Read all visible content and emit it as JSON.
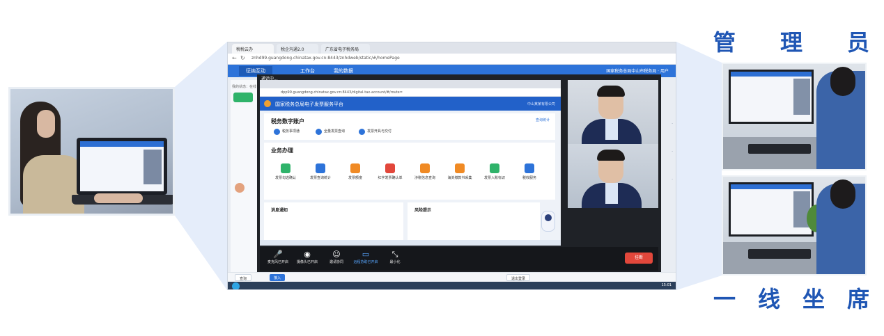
{
  "right_panel": {
    "top_heading_chars": [
      "管",
      "理",
      "员"
    ],
    "bottom_heading_chars": [
      "一",
      "线",
      "坐",
      "席"
    ]
  },
  "left_photo": {
    "icon": "person-at-laptop-photo"
  },
  "screenshot": {
    "browser": {
      "tabs": [
        "税税云办",
        "税企沟通2.0",
        "广东省电子税务局"
      ],
      "url": "znhd99.guangdong.chinatax.gov.cn:8443/znhdweb/static/#/homePage"
    },
    "app_nav": {
      "items": [
        "征纳互动",
        "工作台",
        "我的数据"
      ],
      "user": "国家税务总局中山市税务局 · 用户"
    },
    "left_side_chars": [
      "我的状态：在线",
      "首页"
    ],
    "meeting": {
      "window_title": "通话中...",
      "inner_url": "dpp99.guangdong.chinatax.gov.cn:8443/digital-tax-account/#/route=",
      "portal_title": "国家税务总局电子发票服务平台",
      "portal_right": "中山某某有限公司",
      "account_heading": "税务数字账户",
      "account_link": "查询统计",
      "quick_links": [
        "税务事项通",
        "全量发票查询",
        "发票开具与交付"
      ],
      "business_heading": "业务办理",
      "services": [
        {
          "label": "发票勾选确认",
          "color": "#2fb36a"
        },
        {
          "label": "发票查询统计",
          "color": "#2d73d9"
        },
        {
          "label": "发票额度",
          "color": "#f08a24"
        },
        {
          "label": "红字发票确认单",
          "color": "#e2473b"
        },
        {
          "label": "涉税信息查询",
          "color": "#f08a24"
        },
        {
          "label": "海关缴款书采集",
          "color": "#f08a24"
        },
        {
          "label": "发票入账标识",
          "color": "#2fb36a"
        },
        {
          "label": "税收服务",
          "color": "#2d73d9"
        }
      ],
      "notice_left": "消息通知",
      "notice_right": "风险提示",
      "controls": [
        {
          "label": "麦克风已开启",
          "icon": "microphone-icon",
          "glyph": "🎤"
        },
        {
          "label": "摄像头已开启",
          "icon": "camera-icon",
          "glyph": "◉"
        },
        {
          "label": "邀请协同",
          "icon": "invite-icon",
          "glyph": "☺"
        },
        {
          "label": "远程协助已开启",
          "icon": "screen-share-icon",
          "glyph": "▭"
        },
        {
          "label": "最小化",
          "icon": "minimize-icon",
          "glyph": "⤡"
        }
      ],
      "hangup_label": "挂断"
    },
    "bottom_buttons": [
      "查询",
      "接入",
      "退出登录"
    ],
    "clock": "15:01"
  },
  "colors": {
    "accent_blue": "#1f56b4",
    "app_bar": "#2d73d9",
    "funnel": "#d7e3f7",
    "hangup_red": "#e2473b"
  }
}
